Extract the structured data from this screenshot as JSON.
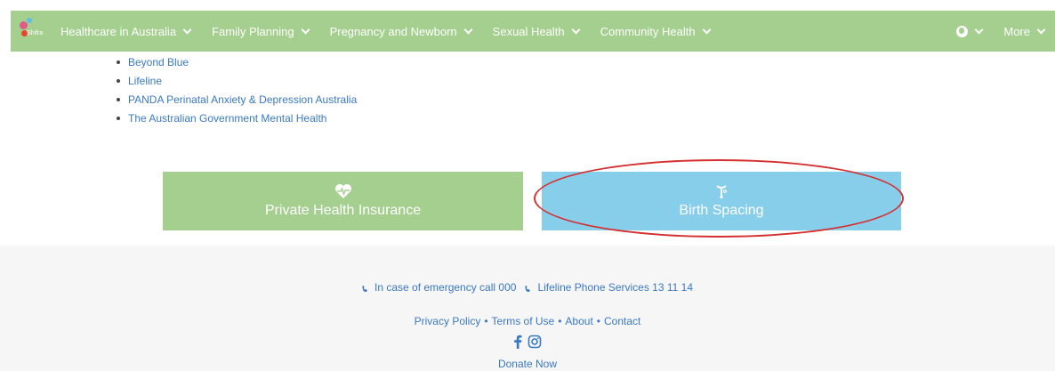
{
  "nav": {
    "logo_text": "Shifra",
    "items": [
      {
        "label": "Healthcare in Australia"
      },
      {
        "label": "Family Planning"
      },
      {
        "label": "Pregnancy and Newborn"
      },
      {
        "label": "Sexual Health"
      },
      {
        "label": "Community Health"
      }
    ],
    "language_icon": "globe-icon",
    "more_label": "More"
  },
  "resources": [
    "Beyond Blue",
    "Lifeline",
    "PANDA Perinatal Anxiety & Depression Australia",
    "The Australian Government Mental Health"
  ],
  "cards": {
    "insurance": {
      "label": "Private Health Insurance",
      "icon": "heartbeat-icon",
      "color": "#a5cf8f"
    },
    "birth_spacing": {
      "label": "Birth Spacing",
      "icon": "iud-icon",
      "color": "#87ceeb"
    }
  },
  "footer": {
    "emergency": "In case of emergency call 000",
    "lifeline": "Lifeline Phone Services 13 11 14",
    "links": [
      "Privacy Policy",
      "Terms of Use",
      "About",
      "Contact"
    ],
    "social_icons": [
      "facebook-icon",
      "instagram-icon"
    ],
    "donate": "Donate Now"
  },
  "colors": {
    "nav_bg": "#a5cf8f",
    "link": "#3a79c2",
    "highlight": "#d43030"
  }
}
